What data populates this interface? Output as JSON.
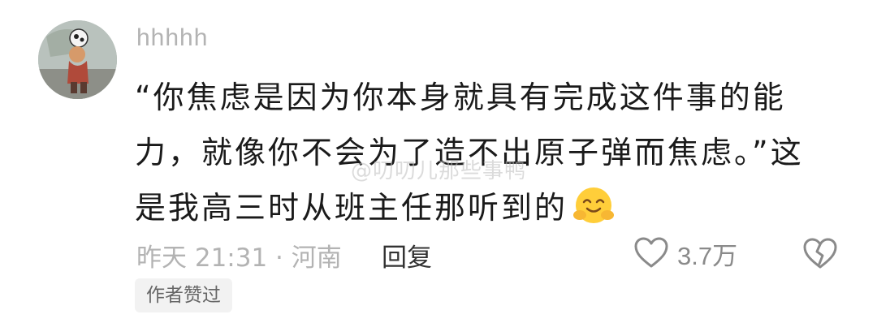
{
  "user": {
    "name": "hhhhh"
  },
  "comment": {
    "lines": [
      "“你焦虑是因为你本身就具有完成这件事的能",
      "力，就像你不会为了造不出原子弹而焦虑。”这",
      "是我高三时从班主任那听到的"
    ],
    "emoji_icon": "smiling-face-with-hands-icon"
  },
  "watermark": "@叨叨儿那些事鸭",
  "meta": {
    "time_location": "昨天 21:31 · 河南",
    "reply_label": "回复"
  },
  "actions": {
    "like_count": "3.7万",
    "like_icon": "heart-icon",
    "dislike_icon": "broken-heart-icon"
  },
  "badge": {
    "label": "作者赞过"
  },
  "colors": {
    "text": "#1a1a1a",
    "muted": "#b3b3b3",
    "badge_bg": "#f2f2f2"
  }
}
